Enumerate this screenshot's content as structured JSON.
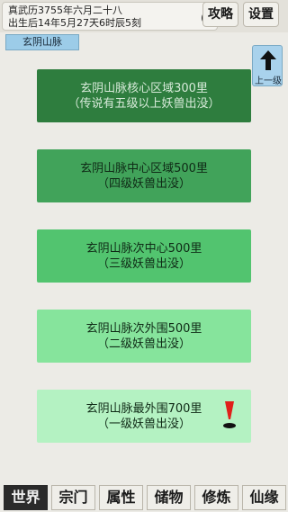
{
  "header": {
    "date_line1": "真武历3755年六月二十八",
    "date_line2": "出生后14年5月27天6时辰5刻",
    "help_label": "?",
    "guide_label": "攻略",
    "settings_label": "设置"
  },
  "location": {
    "current": "玄阴山脉",
    "up_label": "上一级"
  },
  "regions": [
    {
      "name": "玄阴山脉核心区域300里",
      "desc": "（传说有五级以上妖兽出没）"
    },
    {
      "name": "玄阴山脉中心区域500里",
      "desc": "（四级妖兽出没）"
    },
    {
      "name": "玄阴山脉次中心500里",
      "desc": "（三级妖兽出没）"
    },
    {
      "name": "玄阴山脉次外围500里",
      "desc": "（二级妖兽出没）"
    },
    {
      "name": "玄阴山脉最外围700里",
      "desc": "（一级妖兽出没）"
    }
  ],
  "nav": {
    "items": [
      "世界",
      "宗门",
      "属性",
      "储物",
      "修炼",
      "仙缘"
    ],
    "active": "世界"
  },
  "colors": {
    "marker": "#e0201a",
    "active_nav": "#2a2a2a"
  }
}
